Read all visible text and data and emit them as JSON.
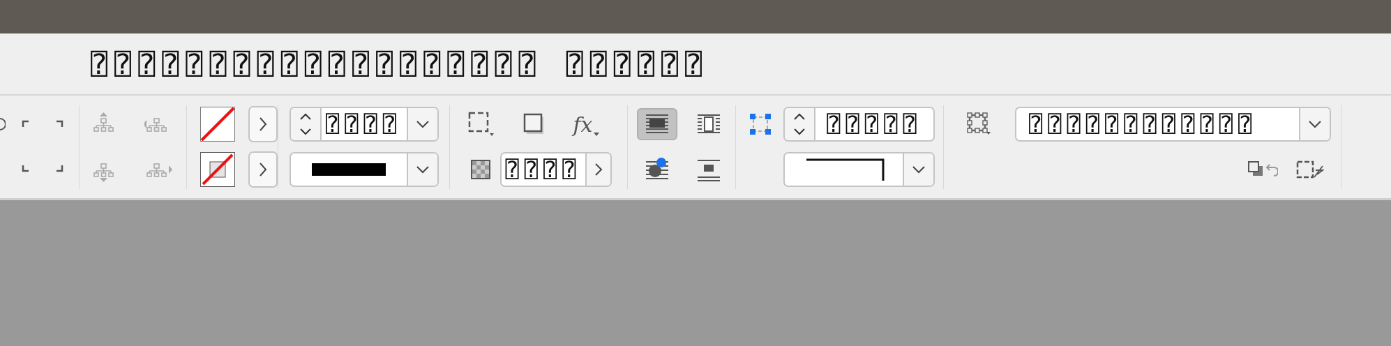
{
  "title": "⍰⍰⍰⍰⍰⍰⍰⍰⍰⍰⍰⍰⍰⍰⍰⍰⍰⍰⍰ ⍰⍰⍰⍰⍰⍰",
  "stroke": {
    "weight": "⍰⍰⍰⍰"
  },
  "opacity": {
    "value": "⍰⍰⍰⍰"
  },
  "effects": {
    "label": "fx"
  },
  "wrap_buttons": [
    {
      "kind": "none",
      "selected": true
    },
    {
      "kind": "box",
      "selected": false
    },
    {
      "kind": "shape",
      "selected": false
    },
    {
      "kind": "jump",
      "selected": false
    }
  ],
  "corner": {
    "size": "⍰⍰⍰⍰⍰"
  },
  "object_style": {
    "value": "⍰⍰⍰⍰⍰⍰⍰⍰⍰⍰⍰⍰"
  }
}
